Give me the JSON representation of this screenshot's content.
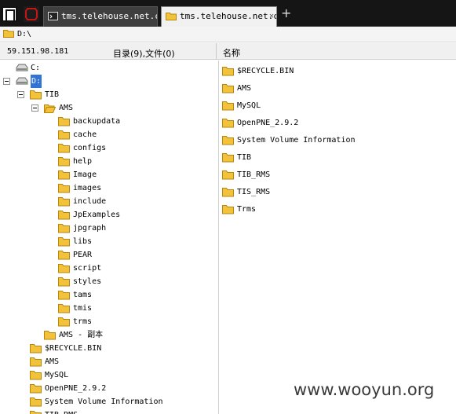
{
  "tabs": [
    {
      "label": "tms.telehouse.net.cn",
      "active": false,
      "icon": "terminal-icon"
    },
    {
      "label": "tms.telehouse.net.cn",
      "active": true,
      "icon": "folder-icon"
    }
  ],
  "path": "D:\\",
  "status": {
    "ip": "59.151.98.181",
    "counts": "目录(9),文件(0)",
    "name_column": "名称"
  },
  "tree": [
    {
      "label": "C:",
      "depth": 0,
      "icon": "drive-icon",
      "toggle": false
    },
    {
      "label": "D:",
      "depth": 0,
      "icon": "drive-icon",
      "toggle": true,
      "selected": true
    },
    {
      "label": "TIB",
      "depth": 1,
      "icon": "folder-icon",
      "toggle": true
    },
    {
      "label": "AMS",
      "depth": 2,
      "icon": "folder-icon",
      "toggle": true,
      "open": true
    },
    {
      "label": "backupdata",
      "depth": 3,
      "icon": "folder-icon"
    },
    {
      "label": "cache",
      "depth": 3,
      "icon": "folder-icon"
    },
    {
      "label": "configs",
      "depth": 3,
      "icon": "folder-icon"
    },
    {
      "label": "help",
      "depth": 3,
      "icon": "folder-icon"
    },
    {
      "label": "Image",
      "depth": 3,
      "icon": "folder-icon"
    },
    {
      "label": "images",
      "depth": 3,
      "icon": "folder-icon"
    },
    {
      "label": "include",
      "depth": 3,
      "icon": "folder-icon"
    },
    {
      "label": "JpExamples",
      "depth": 3,
      "icon": "folder-icon"
    },
    {
      "label": "jpgraph",
      "depth": 3,
      "icon": "folder-icon"
    },
    {
      "label": "libs",
      "depth": 3,
      "icon": "folder-icon"
    },
    {
      "label": "PEAR",
      "depth": 3,
      "icon": "folder-icon"
    },
    {
      "label": "script",
      "depth": 3,
      "icon": "folder-icon"
    },
    {
      "label": "styles",
      "depth": 3,
      "icon": "folder-icon"
    },
    {
      "label": "tams",
      "depth": 3,
      "icon": "folder-icon"
    },
    {
      "label": "tmis",
      "depth": 3,
      "icon": "folder-icon"
    },
    {
      "label": "trms",
      "depth": 3,
      "icon": "folder-icon"
    },
    {
      "label": "AMS - 副本",
      "depth": 2,
      "icon": "folder-icon"
    },
    {
      "label": "$RECYCLE.BIN",
      "depth": 1,
      "icon": "folder-icon"
    },
    {
      "label": "AMS",
      "depth": 1,
      "icon": "folder-icon"
    },
    {
      "label": "MySQL",
      "depth": 1,
      "icon": "folder-icon"
    },
    {
      "label": "OpenPNE_2.9.2",
      "depth": 1,
      "icon": "folder-icon"
    },
    {
      "label": "System Volume Information",
      "depth": 1,
      "icon": "folder-icon"
    },
    {
      "label": "TIB_RMS",
      "depth": 1,
      "icon": "folder-icon"
    }
  ],
  "files": [
    "$RECYCLE.BIN",
    "AMS",
    "MySQL",
    "OpenPNE_2.9.2",
    "System Volume Information",
    "TIB",
    "TIB_RMS",
    "TIS_RMS",
    "Trms"
  ],
  "watermark": "www.wooyun.org",
  "colors": {
    "selection": "#3174d6",
    "folder": "#f2c23b",
    "tabbar": "#151515"
  }
}
